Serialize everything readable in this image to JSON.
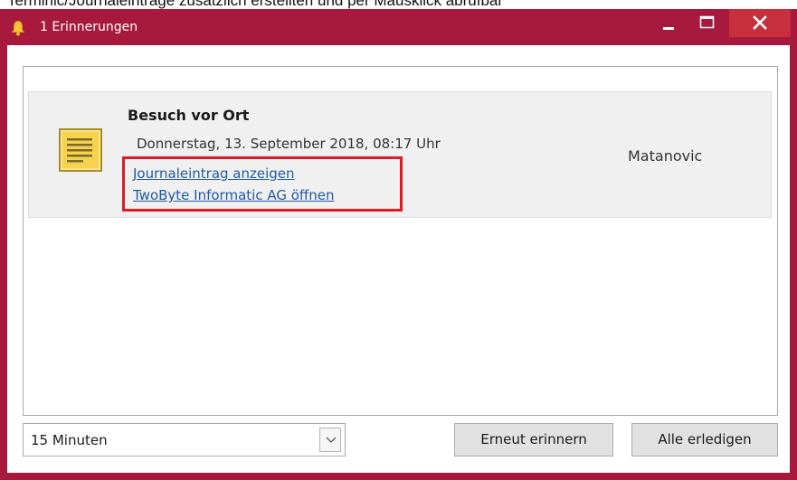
{
  "caption": {
    "text": "Terminic/Journaleinträge zusätzlich erstellten und per Mausklick abrufbar"
  },
  "window": {
    "title": "1 Erinnerungen",
    "accent_color": "#a71a3e",
    "close_color": "#c72f3e",
    "icons": {
      "app": "bell-icon",
      "minimize": "minimize-icon",
      "maximize": "maximize-icon",
      "close": "close-icon"
    }
  },
  "reminder": {
    "icon": "journal-note-icon",
    "title": "Besuch vor Ort",
    "datetime": "Donnerstag, 13. September 2018, 08:17 Uhr",
    "owner": "Matanovic",
    "links": [
      "Journaleintrag anzeigen",
      "TwoByte Informatic AG öffnen"
    ],
    "highlight_color": "#e01a22",
    "link_color": "#1e5aa8"
  },
  "footer": {
    "snooze_selected": "15 Minuten",
    "dropdown_icon": "chevron-down-icon",
    "remind_label": "Erneut erinnern",
    "dismiss_all_label": "Alle erledigen"
  }
}
